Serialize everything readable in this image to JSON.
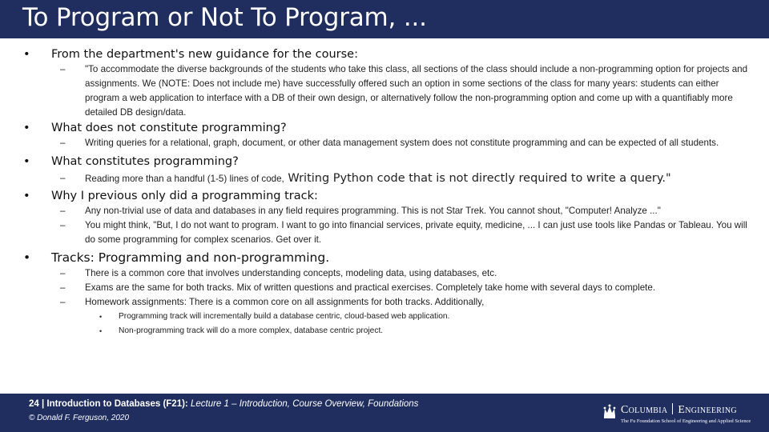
{
  "title": "To Program or Not To Program, ...",
  "bullets": {
    "b1": {
      "text": "From the department's new guidance for the course:",
      "sub1": "\"To accommodate the diverse backgrounds of the students who take this class, all sections of the class should include a non-programming option for projects and assignments. We (NOTE: Does not include me) have successfully offered such an option in some sections of the class for many years: students can either program a web application to interface with a DB of their own design, or alternatively follow the non-programming option and come up with a quantifiably more detailed DB design/data."
    },
    "b2": {
      "text": "What does not constitute programming?",
      "sub1": "Writing queries for a relational, graph, document, or other data management system does not constitute programming and can be expected of all students."
    },
    "b3": {
      "text": "What constitutes programming?",
      "sub1_small": "Reading more than a handful (1-5) lines of code,",
      "sub1_large": " Writing Python code that is not directly required to write a query.\""
    },
    "b4": {
      "text": "Why I previous only did a programming track:",
      "sub1": "Any non-trivial use of data and databases in any field requires programming. This is not Star Trek. You cannot shout, \"Computer! Analyze ...\"",
      "sub2": "You might think, \"But, I do not want to program. I want to go into financial services, private equity, medicine, ... I can just use tools like Pandas or Tableau. You will do some programming for complex scenarios. Get over it."
    },
    "b5": {
      "text": "Tracks: Programming and non-programming.",
      "sub1": "There is a common core that involves understanding concepts, modeling data, using databases, etc.",
      "sub2": "Exams are the same for both tracks. Mix of written questions and practical exercises. Completely take home with several days to complete.",
      "sub3": "Homework assignments: There is a common core on all assignments for both tracks. Additionally,",
      "sub3_items": [
        "Programming track will incrementally build a database centric, cloud-based web application.",
        "Non-programming track will do a more complex, database centric project."
      ]
    }
  },
  "footer": {
    "page_number": "24",
    "course": "Introduction to Databases (F21):",
    "lecture": "Lecture 1 – Introduction, Course Overview, Foundations",
    "copyright": "© Donald F. Ferguson, 2020"
  },
  "logo": {
    "name_left": "Columbia",
    "name_right": "Engineering",
    "subtitle": "The Fu Foundation School of Engineering and Applied Science"
  },
  "colors": {
    "bar": "#1f2d5f",
    "bar_text": "#ffffff"
  }
}
